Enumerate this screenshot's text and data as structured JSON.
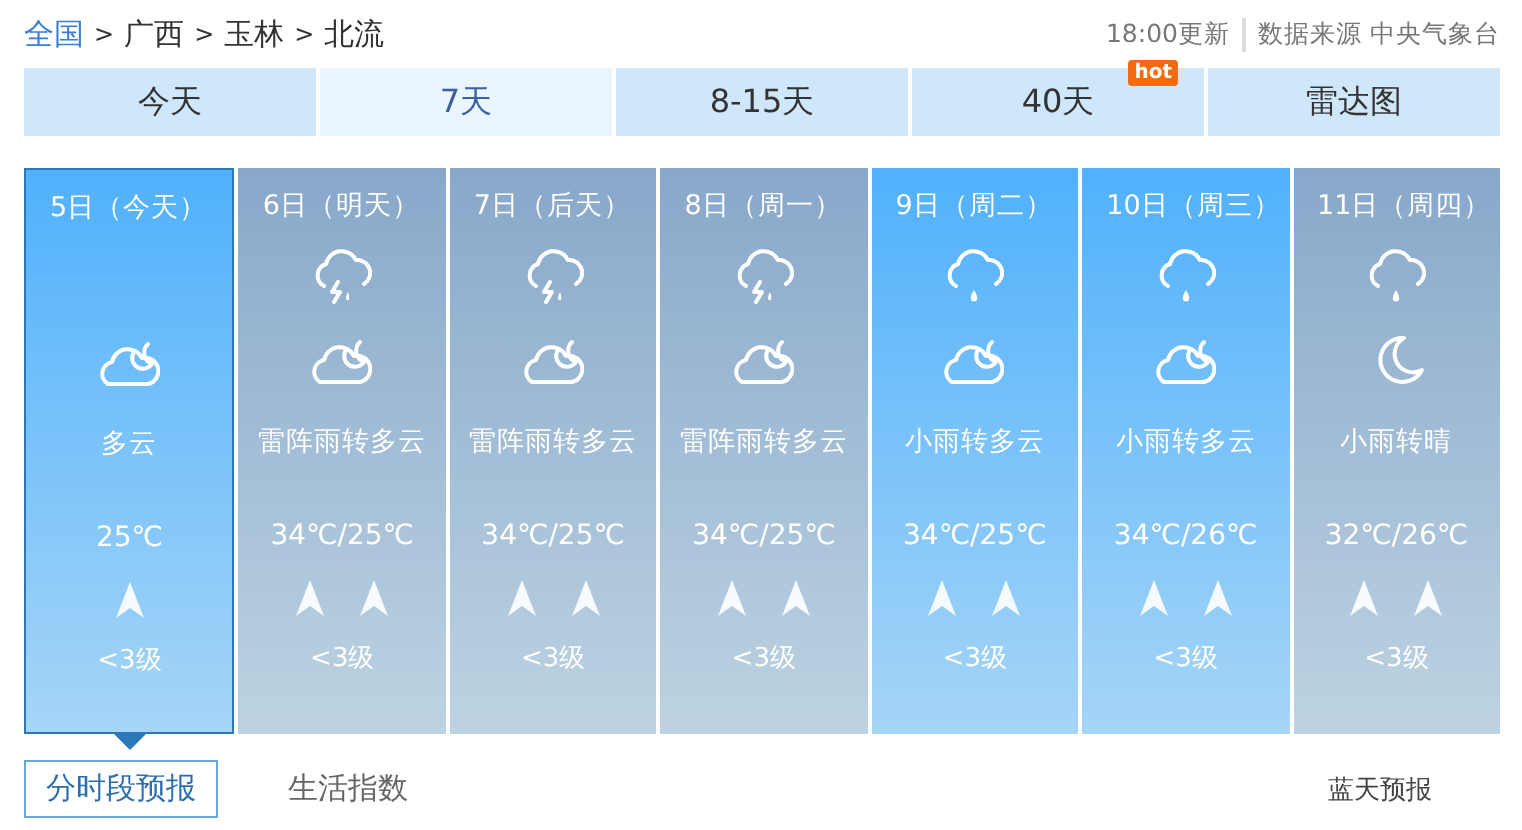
{
  "breadcrumb": [
    {
      "label": "全国",
      "link": true
    },
    {
      "label": ">",
      "link": false
    },
    {
      "label": "广西",
      "link": false
    },
    {
      "label": ">",
      "link": false
    },
    {
      "label": "玉林",
      "link": false
    },
    {
      "label": ">",
      "link": false
    },
    {
      "label": "北流",
      "link": false
    }
  ],
  "update_time": "18:00更新",
  "source": "数据来源 中央气象台",
  "tabs": [
    {
      "label": "今天",
      "selected": false
    },
    {
      "label": "7天",
      "selected": true
    },
    {
      "label": "8-15天",
      "selected": false
    },
    {
      "label": "40天",
      "selected": false,
      "badge": "hot"
    },
    {
      "label": "雷达图",
      "selected": false
    }
  ],
  "days": [
    {
      "date": "5日（今天）",
      "selected": true,
      "kind": "highlight",
      "night_icon": {
        "kind": "cloud-moon"
      },
      "weather": "多云",
      "temp": "25℃",
      "winds": [
        {
          "kind": "up"
        }
      ],
      "wind_level": "<3级"
    },
    {
      "date": "6日（明天）",
      "selected": false,
      "kind": "plain",
      "day_icon": {
        "kind": "thunder-rain"
      },
      "night_icon": {
        "kind": "cloud-moon"
      },
      "weather": "雷阵雨转多云",
      "temp": "34℃/25℃",
      "winds": [
        {
          "kind": "up"
        },
        {
          "kind": "up"
        }
      ],
      "wind_level": "<3级"
    },
    {
      "date": "7日（后天）",
      "selected": false,
      "kind": "plain",
      "day_icon": {
        "kind": "thunder-rain"
      },
      "night_icon": {
        "kind": "cloud-moon"
      },
      "weather": "雷阵雨转多云",
      "temp": "34℃/25℃",
      "winds": [
        {
          "kind": "up"
        },
        {
          "kind": "up"
        }
      ],
      "wind_level": "<3级"
    },
    {
      "date": "8日（周一）",
      "selected": false,
      "kind": "plain",
      "day_icon": {
        "kind": "thunder-rain"
      },
      "night_icon": {
        "kind": "cloud-moon"
      },
      "weather": "雷阵雨转多云",
      "temp": "34℃/25℃",
      "winds": [
        {
          "kind": "up"
        },
        {
          "kind": "up"
        }
      ],
      "wind_level": "<3级"
    },
    {
      "date": "9日（周二）",
      "selected": false,
      "kind": "highlight",
      "day_icon": {
        "kind": "rain"
      },
      "night_icon": {
        "kind": "cloud-moon"
      },
      "weather": "小雨转多云",
      "temp": "34℃/25℃",
      "winds": [
        {
          "kind": "up"
        },
        {
          "kind": "up"
        }
      ],
      "wind_level": "<3级"
    },
    {
      "date": "10日（周三）",
      "selected": false,
      "kind": "highlight",
      "day_icon": {
        "kind": "rain"
      },
      "night_icon": {
        "kind": "cloud-moon"
      },
      "weather": "小雨转多云",
      "temp": "34℃/26℃",
      "winds": [
        {
          "kind": "up"
        },
        {
          "kind": "up"
        }
      ],
      "wind_level": "<3级"
    },
    {
      "date": "11日（周四）",
      "selected": false,
      "kind": "plain",
      "day_icon": {
        "kind": "rain"
      },
      "night_icon": {
        "kind": "moon"
      },
      "weather": "小雨转晴",
      "temp": "32℃/26℃",
      "winds": [
        {
          "kind": "up"
        },
        {
          "kind": "up"
        }
      ],
      "wind_level": "<3级"
    }
  ],
  "bottom_tabs": [
    {
      "label": "分时段预报",
      "selected": true
    },
    {
      "label": "生活指数",
      "selected": false
    }
  ],
  "side_link": "蓝天预报"
}
